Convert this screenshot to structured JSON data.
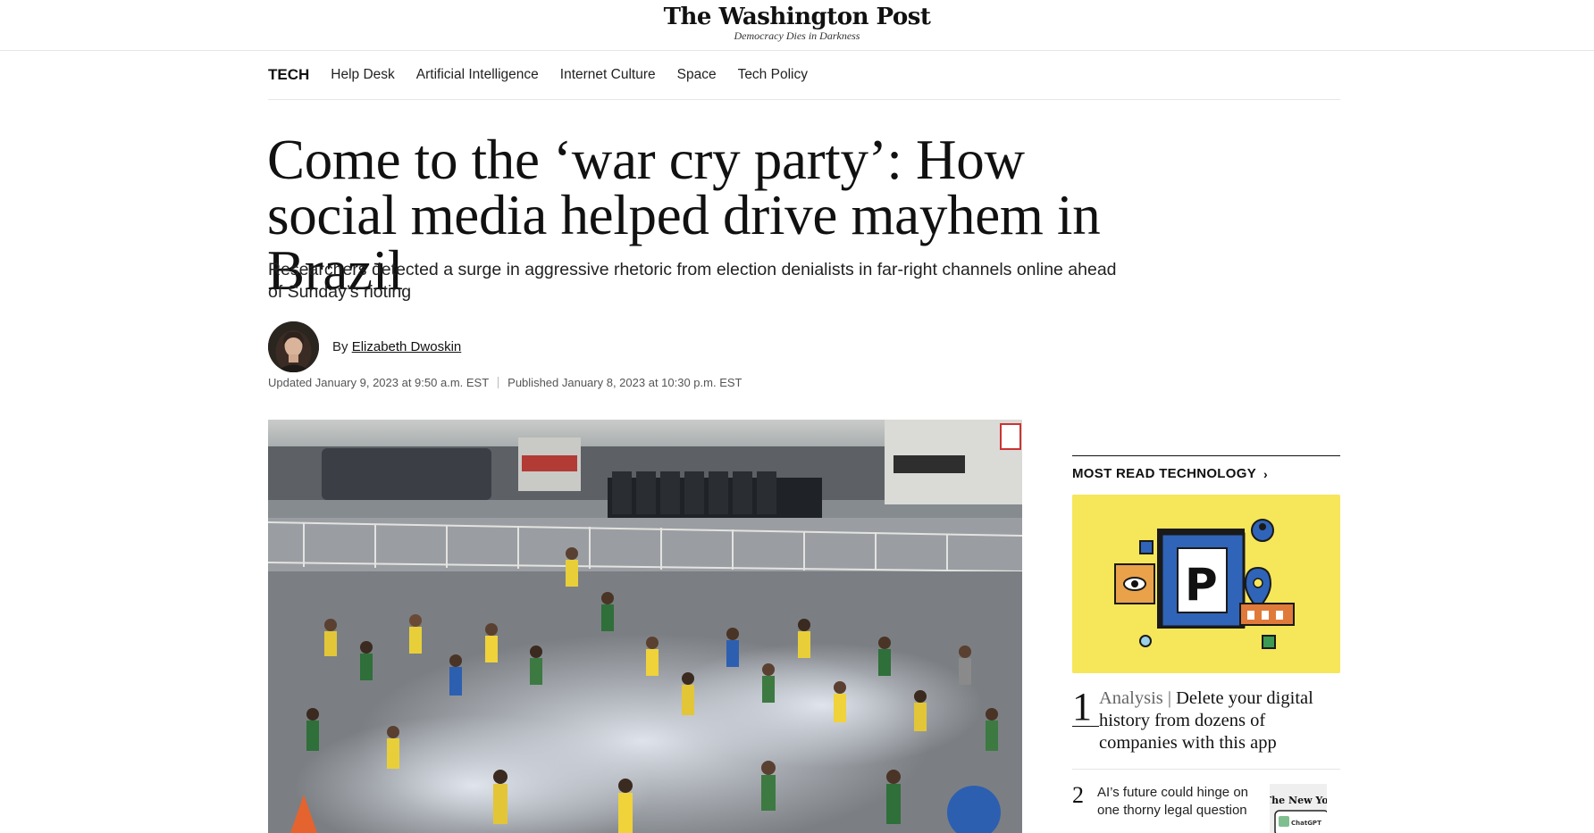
{
  "masthead": {
    "logo_text": "The Washington Post",
    "tagline": "Democracy Dies in Darkness"
  },
  "subnav": {
    "section": "TECH",
    "links": [
      "Help Desk",
      "Artificial Intelligence",
      "Internet Culture",
      "Space",
      "Tech Policy"
    ]
  },
  "article": {
    "headline": "Come to the ‘war cry party’: How social media helped drive mayhem in Brazil",
    "dek": "Researchers detected a surge in aggressive rhetoric from election denialists in far-right channels online ahead of Sunday’s rioting",
    "byline_prefix": "By",
    "author": "Elizabeth Dwoskin",
    "updated": "Updated January 9, 2023 at 9:50 a.m. EST",
    "published": "Published January 8, 2023 at 10:30 p.m. EST"
  },
  "sidebar": {
    "title": "MOST READ TECHNOLOGY",
    "chevron": "›",
    "items": [
      {
        "num": "1",
        "kicker": "Analysis",
        "sep": " | ",
        "text": "Delete your digital history from dozens of companies with this app"
      },
      {
        "num": "2",
        "text": "AI’s future could hinge on one thorny legal question",
        "thumb_label": "ChatGPT",
        "thumb_masthead": "The New York Times"
      }
    ]
  },
  "colors": {
    "promo_bg": "#f6e65a",
    "promo_blue": "#2f64b8",
    "promo_orange": "#e9a24a"
  }
}
